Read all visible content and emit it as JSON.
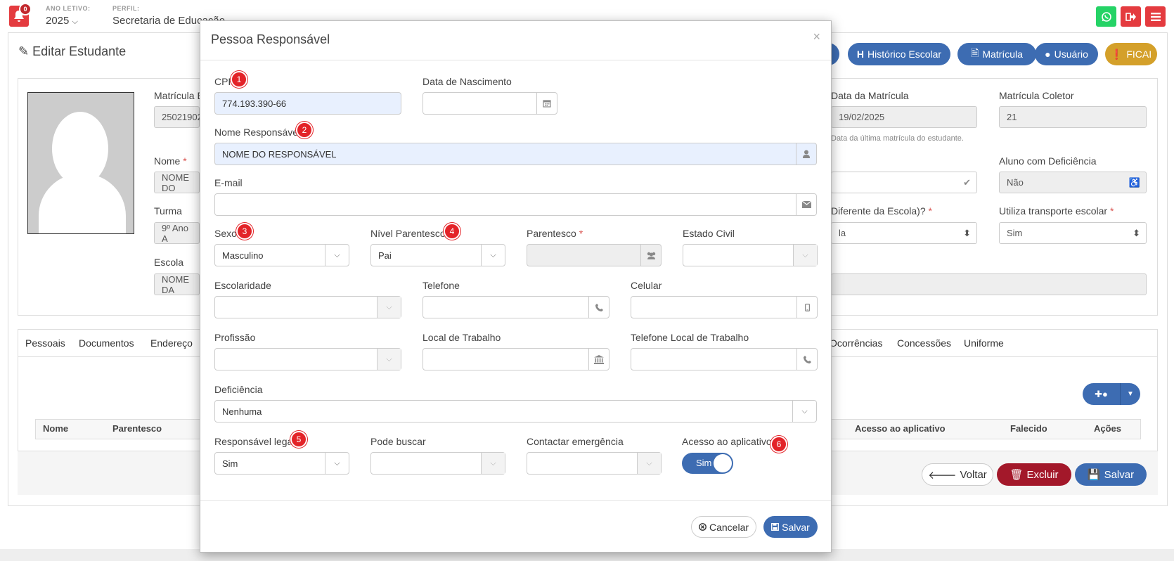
{
  "topbar": {
    "notifications_count": "0",
    "ano_letivo_label": "ANO LETIVO:",
    "ano_letivo_value": "2025",
    "perfil_label": "PERFIL:",
    "perfil_value": "Secretaria de Educação"
  },
  "page": {
    "title": "Editar Estudante",
    "actions": [
      {
        "label": "Histórico Escolar"
      },
      {
        "label": "Matrícula"
      },
      {
        "label": "Usuário"
      },
      {
        "label": "FICAI"
      }
    ],
    "fields": {
      "matricula_label": "Matrícula E",
      "matricula_value": "25021902",
      "nome_label": "Nome",
      "nome_value": "NOME DO",
      "turma_label": "Turma",
      "turma_value": "9º Ano A",
      "escola_label": "Escola",
      "escola_value": "NOME DA",
      "data_matricula_label": "Data da Matrícula",
      "data_matricula_value": "19/02/2025",
      "data_matricula_help": "Data da última matrícula do estudante.",
      "matricula_coletor_label": "Matrícula Coletor",
      "matricula_coletor_value": "21",
      "aluno_deficiencia_label": "Aluno com Deficiência",
      "aluno_deficiencia_value": "Não",
      "diferente_escola_label": "Diferente da Escola)?",
      "diferente_escola_value": "la",
      "transporte_label": "Utiliza transporte escolar",
      "transporte_value": "Sim"
    },
    "tabs": [
      "Pessoais",
      "Documentos",
      "Endereço",
      "Ocorrências",
      "Concessões",
      "Uniforme"
    ],
    "table_headers": [
      "Nome",
      "Parentesco",
      "Acesso ao aplicativo",
      "Falecido",
      "Ações"
    ],
    "bottom_buttons": {
      "voltar": "Voltar",
      "excluir": "Excluir",
      "salvar": "Salvar"
    }
  },
  "modal": {
    "title": "Pessoa Responsável",
    "close": "×",
    "fields": {
      "cpf_label": "CPF",
      "cpf_value": "774.193.390-66",
      "nascimento_label": "Data de Nascimento",
      "nascimento_value": "",
      "nome_label": "Nome Responsável",
      "nome_value": "NOME DO RESPONSÁVEL",
      "email_label": "E-mail",
      "email_value": "",
      "sexo_label": "Sexo",
      "sexo_value": "Masculino",
      "nivel_parentesco_label": "Nível Parentesco",
      "nivel_parentesco_value": "Pai",
      "parentesco_label": "Parentesco",
      "parentesco_value": "",
      "estado_civil_label": "Estado Civil",
      "estado_civil_value": "",
      "escolaridade_label": "Escolaridade",
      "escolaridade_value": "",
      "telefone_label": "Telefone",
      "telefone_value": "",
      "celular_label": "Celular",
      "celular_value": "",
      "profissao_label": "Profissão",
      "profissao_value": "",
      "local_trabalho_label": "Local de Trabalho",
      "local_trabalho_value": "",
      "telefone_trabalho_label": "Telefone Local de Trabalho",
      "telefone_trabalho_value": "",
      "deficiencia_label": "Deficiência",
      "deficiencia_value": "Nenhuma",
      "responsavel_legal_label": "Responsável legal",
      "responsavel_legal_value": "Sim",
      "pode_buscar_label": "Pode buscar",
      "pode_buscar_value": "",
      "contactar_emergencia_label": "Contactar emergência",
      "contactar_emergencia_value": "",
      "acesso_aplicativo_label": "Acesso ao aplicativo",
      "acesso_aplicativo_value": "Sim"
    },
    "badges": [
      "1",
      "2",
      "3",
      "4",
      "5",
      "6"
    ],
    "buttons": {
      "cancelar": "Cancelar",
      "salvar": "Salvar"
    }
  },
  "colors": {
    "primary": "#3d6cb2",
    "danger": "#a3182a",
    "warning": "#d4a02a",
    "whatsapp": "#25d366",
    "red": "#e43b3f",
    "badge": "#e32328"
  },
  "icons": [
    "bell-icon",
    "whatsapp-icon",
    "sign-out-icon",
    "menu-icon",
    "edit-icon",
    "calendar-icon",
    "user-icon",
    "envelope-icon",
    "chevron-down-icon",
    "users-icon",
    "phone-icon",
    "mobile-icon",
    "bank-icon",
    "check-icon",
    "wheelchair-icon",
    "times-circle-icon",
    "save-icon",
    "trash-icon",
    "arrow-left-icon"
  ]
}
